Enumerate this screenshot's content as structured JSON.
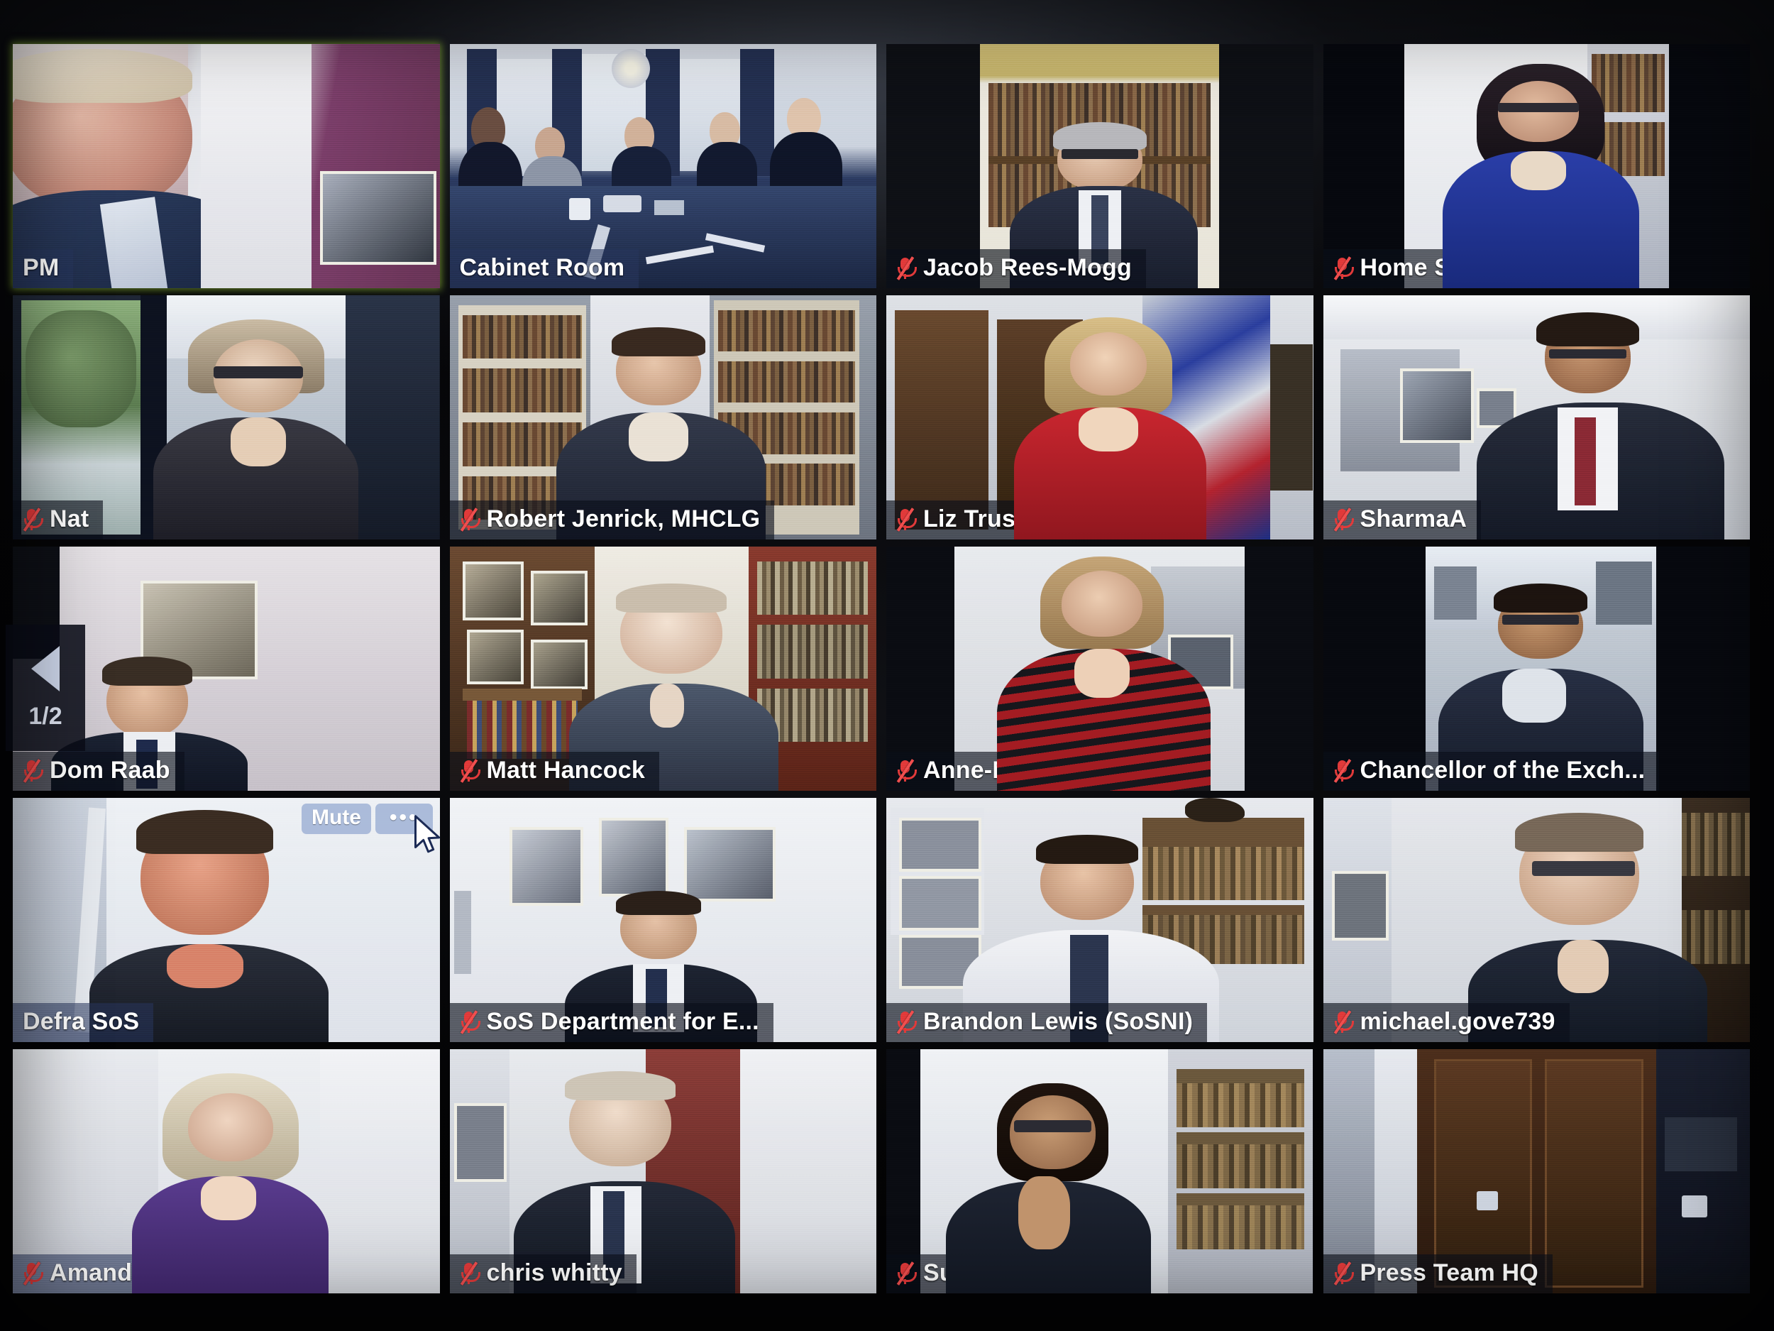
{
  "app": {
    "kind": "video-conference-grid",
    "active_speaker_border_color": "#a6d93a",
    "muted_icon_color": "#e23b3b",
    "rows": 5,
    "columns": 4
  },
  "pagination": {
    "prev_label": "◀",
    "page_indicator": "1/2"
  },
  "hover_controls": {
    "mute_label": "Mute",
    "more_label": "•••",
    "on_tile": "Defra SoS"
  },
  "participants": [
    {
      "id": 1,
      "name": "PM",
      "muted": false,
      "active_speaker": true,
      "label_style": "plain"
    },
    {
      "id": 2,
      "name": "Cabinet Room",
      "muted": false,
      "active_speaker": false,
      "label_style": "plain"
    },
    {
      "id": 3,
      "name": "Jacob Rees-Mogg",
      "muted": true,
      "active_speaker": false,
      "label_style": "dark"
    },
    {
      "id": 4,
      "name": "Home Secretary",
      "muted": true,
      "active_speaker": false,
      "label_style": "dark"
    },
    {
      "id": 5,
      "name": "Nat",
      "muted": true,
      "active_speaker": false,
      "label_style": "dark"
    },
    {
      "id": 6,
      "name": "Robert Jenrick, MHCLG",
      "muted": true,
      "active_speaker": false,
      "label_style": "dark"
    },
    {
      "id": 7,
      "name": "Liz Truss",
      "muted": true,
      "active_speaker": false,
      "label_style": "dark"
    },
    {
      "id": 8,
      "name": "SharmaA",
      "muted": true,
      "active_speaker": false,
      "label_style": "dark"
    },
    {
      "id": 9,
      "name": "Dom Raab",
      "muted": true,
      "active_speaker": false,
      "label_style": "dark"
    },
    {
      "id": 10,
      "name": "Matt Hancock",
      "muted": true,
      "active_speaker": false,
      "label_style": "dark"
    },
    {
      "id": 11,
      "name": "Anne-Marie Trevelyan",
      "muted": true,
      "active_speaker": false,
      "label_style": "dark"
    },
    {
      "id": 12,
      "name": "Chancellor of the Exch...",
      "muted": true,
      "active_speaker": false,
      "label_style": "dark"
    },
    {
      "id": 13,
      "name": "Defra SoS",
      "muted": false,
      "active_speaker": false,
      "label_style": "plain"
    },
    {
      "id": 14,
      "name": "SoS Department for E...",
      "muted": true,
      "active_speaker": false,
      "label_style": "dark"
    },
    {
      "id": 15,
      "name": "Brandon Lewis (SoSNI)",
      "muted": true,
      "active_speaker": false,
      "label_style": "dark"
    },
    {
      "id": 16,
      "name": "michael.gove739",
      "muted": true,
      "active_speaker": false,
      "label_style": "dark"
    },
    {
      "id": 17,
      "name": "Amanda Milling",
      "muted": true,
      "active_speaker": false,
      "label_style": "plain"
    },
    {
      "id": 18,
      "name": "chris whitty",
      "muted": true,
      "active_speaker": false,
      "label_style": "dark"
    },
    {
      "id": 19,
      "name": "Suella Braverman",
      "muted": true,
      "active_speaker": false,
      "label_style": "dark"
    },
    {
      "id": 20,
      "name": "Press Team HQ",
      "muted": true,
      "active_speaker": false,
      "label_style": "dark"
    }
  ]
}
